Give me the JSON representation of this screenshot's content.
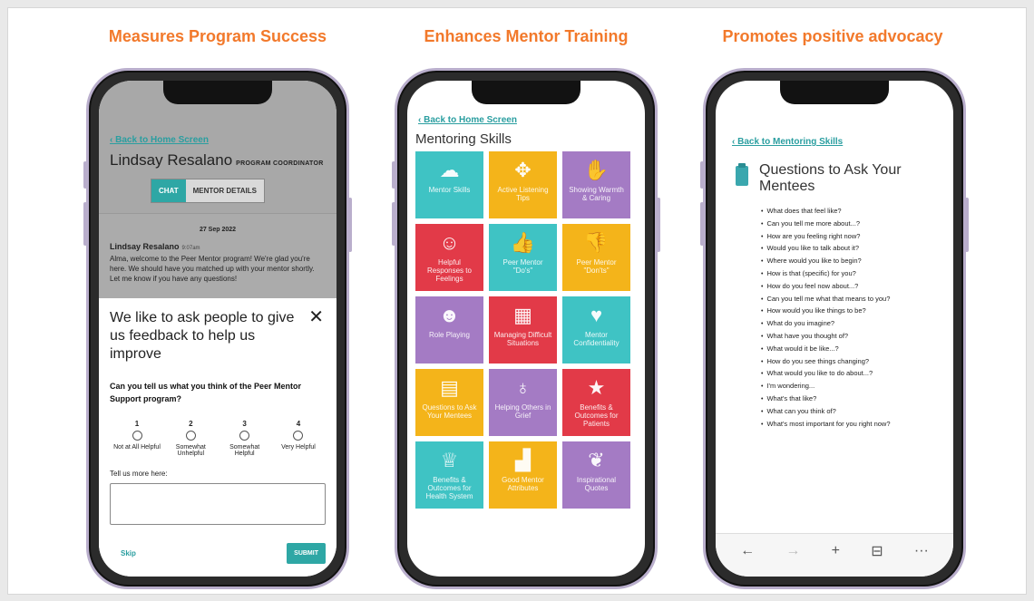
{
  "headings": [
    "Measures Program Success",
    "Enhances Mentor Training",
    "Promotes positive advocacy"
  ],
  "phone1": {
    "back": "‹  Back to Home Screen",
    "name": "Lindsay Resalano",
    "role": "PROGRAM COORDINATOR",
    "tabs": [
      "CHAT",
      "MENTOR DETAILS"
    ],
    "date": "27 Sep 2022",
    "sender": "Lindsay Resalano",
    "time": "9:07am",
    "message": "Alma, welcome to the Peer Mentor program! We're glad you're here. We should have you matched up with your mentor shortly. Let me know if you have any questions!",
    "survey_title": "We like to ask people to give us feedback to help us improve",
    "close": "✕",
    "question": "Can you tell us what you think of the Peer Mentor Support program?",
    "options": [
      {
        "num": "1",
        "label": "Not at All Helpful"
      },
      {
        "num": "2",
        "label": "Somewhat Unhelpful"
      },
      {
        "num": "3",
        "label": "Somewhat Helpful"
      },
      {
        "num": "4",
        "label": "Very Helpful"
      }
    ],
    "more_label": "Tell us more here:",
    "skip": "Skip",
    "submit": "SUBMIT"
  },
  "phone2": {
    "back": "‹  Back to Home Screen",
    "title": "Mentoring Skills",
    "tiles": [
      {
        "label": "Mentor Skills",
        "icon": "brain-icon",
        "glyph": "☁",
        "color": "#3fc3c4"
      },
      {
        "label": "Active Listening Tips",
        "icon": "listening-icon",
        "glyph": "✥",
        "color": "#f4b41a"
      },
      {
        "label": "Showing Warmth & Caring",
        "icon": "hand-heart-icon",
        "glyph": "✋",
        "color": "#a47bc4"
      },
      {
        "label": "Helpful Responses to Feelings",
        "icon": "feelings-icon",
        "glyph": "☺",
        "color": "#e23a48"
      },
      {
        "label": "Peer Mentor \"Do's\"",
        "icon": "thumbs-up-icon",
        "glyph": "👍",
        "color": "#3fc3c4"
      },
      {
        "label": "Peer Mentor \"Don'ts\"",
        "icon": "thumbs-down-icon",
        "glyph": "👎",
        "color": "#f4b41a"
      },
      {
        "label": "Role Playing",
        "icon": "masks-icon",
        "glyph": "☻",
        "color": "#a47bc4"
      },
      {
        "label": "Managing Difficult Situations",
        "icon": "maze-icon",
        "glyph": "▦",
        "color": "#e23a48"
      },
      {
        "label": "Mentor Confidentiality",
        "icon": "heart-icon",
        "glyph": "♥",
        "color": "#3fc3c4"
      },
      {
        "label": "Questions to Ask Your Mentees",
        "icon": "clipboard-icon",
        "glyph": "▤",
        "color": "#f4b41a"
      },
      {
        "label": "Helping Others in Grief",
        "icon": "grief-icon",
        "glyph": "♁",
        "color": "#a47bc4"
      },
      {
        "label": "Benefits & Outcomes for Patients",
        "icon": "star-icon",
        "glyph": "★",
        "color": "#e23a48"
      },
      {
        "label": "Benefits & Outcomes for Health System",
        "icon": "award-icon",
        "glyph": "♕",
        "color": "#3fc3c4"
      },
      {
        "label": "Good Mentor Attributes",
        "icon": "steps-icon",
        "glyph": "▟",
        "color": "#f4b41a"
      },
      {
        "label": "Inspirational Quotes",
        "icon": "wings-icon",
        "glyph": "❦",
        "color": "#a47bc4"
      }
    ]
  },
  "phone3": {
    "back": "‹  Back to Mentoring Skills",
    "title": "Questions to Ask Your Mentees",
    "questions": [
      "What does that feel like?",
      "Can you tell me more about...?",
      "How are you feeling right now?",
      "Would you like to talk about it?",
      "Where would you like to begin?",
      "How is that (specific) for you?",
      "How do you feel now about...?",
      "Can you tell me what that means to you?",
      "How would you like things to be?",
      "What do you imagine?",
      "What have you thought of?",
      "What would it be like...?",
      "How do you see things changing?",
      "What would you like to do about...?",
      "I'm wondering...",
      "What's that like?",
      "What can you think of?",
      "What's most important for you right now?"
    ],
    "browser_bar": {
      "back": "←",
      "forward": "→",
      "new_tab": "+",
      "tabs": "⊟",
      "menu": "···"
    }
  }
}
